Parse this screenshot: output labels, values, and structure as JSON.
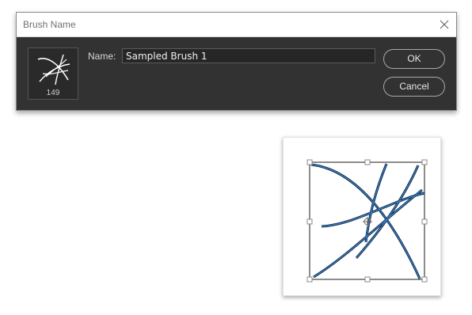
{
  "dialog": {
    "title": "Brush Name",
    "name_label": "Name:",
    "name_value": "Sampled Brush 1",
    "ok_label": "OK",
    "cancel_label": "Cancel",
    "preview": {
      "icon": "brush-tip-preview-icon",
      "size": "149"
    },
    "close_icon": "close-icon"
  },
  "canvas": {
    "icon": "brush-strokes-artwork",
    "stroke_colors": [
      "#0a1e3c",
      "#3a7fc0"
    ]
  }
}
